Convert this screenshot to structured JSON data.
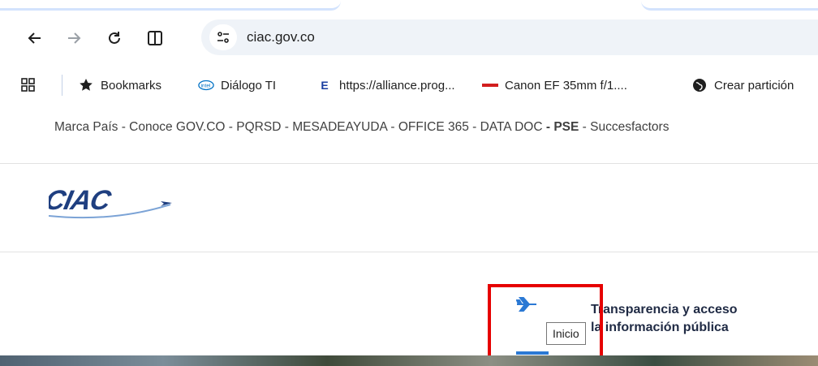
{
  "browser": {
    "url": "ciac.gov.co"
  },
  "bookmarks": {
    "items": [
      {
        "label": "Bookmarks",
        "icon": "star-icon"
      },
      {
        "label": "Diálogo TI",
        "icon": "intel-icon"
      },
      {
        "label": "https://alliance.prog...",
        "icon": "e-icon"
      },
      {
        "label": "Canon EF 35mm f/1....",
        "icon": "canon-icon"
      },
      {
        "label": "Crear partición",
        "icon": "globe-icon"
      }
    ]
  },
  "topnav": {
    "marca": "Marca País",
    "conoce": "Conoce GOV.CO",
    "pqrsd": "PQRSD",
    "mesa": "MESADEAYUDA",
    "office": "OFFICE 365",
    "datadoc": "DATA DOC",
    "pse": "PSE",
    "success": "Succesfactors",
    "sep": " - "
  },
  "logo": {
    "text": "CIAC"
  },
  "menu": {
    "transparencia_line1": "Transparencia y acceso",
    "transparencia_line2": "la información pública",
    "tooltip": "Inicio"
  },
  "colors": {
    "accent": "#2b79d4",
    "highlight": "#e60000",
    "logo": "#1f3f80"
  }
}
